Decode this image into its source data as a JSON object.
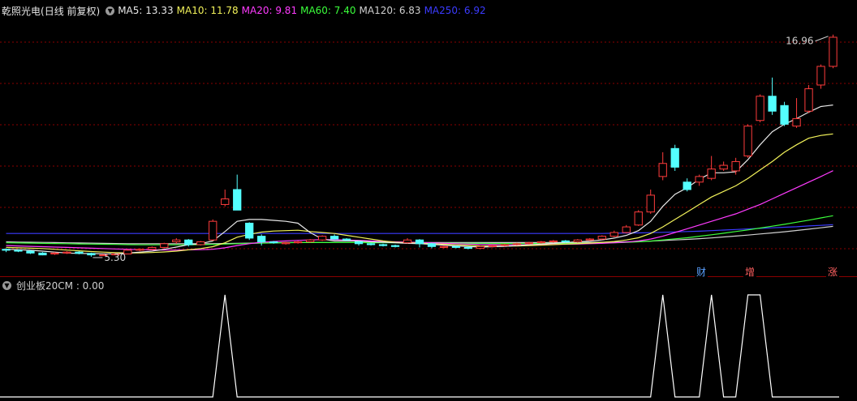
{
  "header": {
    "stock_name": "乾照光电",
    "period": "(日线 前复权)",
    "ma_labels": [
      {
        "text": "MA5: 13.33",
        "color": "#e8e8e8"
      },
      {
        "text": "MA10: 11.78",
        "color": "#f2f25a"
      },
      {
        "text": "MA20: 9.81",
        "color": "#ff3bff"
      },
      {
        "text": "MA60: 7.40",
        "color": "#3bff3b"
      },
      {
        "text": "MA120: 6.83",
        "color": "#cfcfcf"
      },
      {
        "text": "MA250: 6.92",
        "color": "#3b3bff"
      }
    ]
  },
  "annotations": {
    "high_label": "16.96",
    "low_label": "5.30",
    "markers": [
      {
        "text": "财",
        "color": "#5aa0ff",
        "index": 55
      },
      {
        "text": "增",
        "color": "#ff6060",
        "index": 60
      },
      {
        "text": "涨",
        "color": "#ff6060",
        "index": 68
      }
    ]
  },
  "indicator": {
    "label": "创业板20CM : 0.00",
    "color": "#ffffff"
  },
  "colors": {
    "up": "#ff3c3c",
    "down": "#54ffff",
    "grid": "#8b0000",
    "ma5": "#e8e8e8",
    "ma10": "#f2f25a",
    "ma20": "#ff3bff",
    "ma60": "#3bff3b",
    "ma120": "#cfcfcf",
    "ma250": "#3b3bff"
  },
  "chart_data": {
    "type": "candlestick",
    "title": "乾照光电",
    "yrange": [
      4.2,
      18.0
    ],
    "candles": [
      [
        5.6,
        5.55,
        5.65,
        5.45
      ],
      [
        5.55,
        5.5,
        5.6,
        5.45
      ],
      [
        5.5,
        5.4,
        5.55,
        5.35
      ],
      [
        5.4,
        5.3,
        5.45,
        5.28
      ],
      [
        5.35,
        5.4,
        5.45,
        5.3
      ],
      [
        5.4,
        5.45,
        5.5,
        5.35
      ],
      [
        5.45,
        5.38,
        5.5,
        5.33
      ],
      [
        5.38,
        5.3,
        5.42,
        5.2
      ],
      [
        5.3,
        5.3,
        5.35,
        5.3
      ],
      [
        5.3,
        5.35,
        5.4,
        5.3
      ],
      [
        5.35,
        5.55,
        5.6,
        5.35
      ],
      [
        5.55,
        5.6,
        5.65,
        5.5
      ],
      [
        5.6,
        5.7,
        5.75,
        5.55
      ],
      [
        5.7,
        5.9,
        5.95,
        5.65
      ],
      [
        6.0,
        6.1,
        6.2,
        5.9
      ],
      [
        6.1,
        5.85,
        6.15,
        5.75
      ],
      [
        5.85,
        6.0,
        6.05,
        5.8
      ],
      [
        6.1,
        7.1,
        7.2,
        6.05
      ],
      [
        8.0,
        8.3,
        8.8,
        7.9
      ],
      [
        8.8,
        7.7,
        9.6,
        7.7
      ],
      [
        7.0,
        6.2,
        7.05,
        6.1
      ],
      [
        6.3,
        6.0,
        6.4,
        5.8
      ],
      [
        6.0,
        5.95,
        6.05,
        5.9
      ],
      [
        5.9,
        5.95,
        6.0,
        5.85
      ],
      [
        5.95,
        6.0,
        6.05,
        5.9
      ],
      [
        6.0,
        6.1,
        6.15,
        5.95
      ],
      [
        6.1,
        6.3,
        6.35,
        6.05
      ],
      [
        6.3,
        6.15,
        6.4,
        6.1
      ],
      [
        6.15,
        6.1,
        6.2,
        6.05
      ],
      [
        6.0,
        5.9,
        6.05,
        5.8
      ],
      [
        5.9,
        5.85,
        5.95,
        5.8
      ],
      [
        5.85,
        5.8,
        5.9,
        5.75
      ],
      [
        5.8,
        5.75,
        5.85,
        5.7
      ],
      [
        5.95,
        6.1,
        6.2,
        5.9
      ],
      [
        6.1,
        5.9,
        6.15,
        5.7
      ],
      [
        5.9,
        5.75,
        5.95,
        5.65
      ],
      [
        5.7,
        5.75,
        5.8,
        5.65
      ],
      [
        5.75,
        5.7,
        5.8,
        5.65
      ],
      [
        5.7,
        5.65,
        5.75,
        5.6
      ],
      [
        5.65,
        5.75,
        5.8,
        5.6
      ],
      [
        5.75,
        5.8,
        5.85,
        5.7
      ],
      [
        5.8,
        5.85,
        5.9,
        5.75
      ],
      [
        5.85,
        5.9,
        5.95,
        5.8
      ],
      [
        5.9,
        5.95,
        6.0,
        5.85
      ],
      [
        5.95,
        6.0,
        6.05,
        5.9
      ],
      [
        6.0,
        6.05,
        6.1,
        5.95
      ],
      [
        6.05,
        6.0,
        6.1,
        5.95
      ],
      [
        6.0,
        6.1,
        6.15,
        5.95
      ],
      [
        6.1,
        6.15,
        6.2,
        6.05
      ],
      [
        6.15,
        6.3,
        6.35,
        6.1
      ],
      [
        6.3,
        6.5,
        6.6,
        6.25
      ],
      [
        6.5,
        6.8,
        6.9,
        6.45
      ],
      [
        6.9,
        7.6,
        7.7,
        6.85
      ],
      [
        7.6,
        8.5,
        8.8,
        7.5
      ],
      [
        9.5,
        10.2,
        10.8,
        9.3
      ],
      [
        11.0,
        10.0,
        11.2,
        9.8
      ],
      [
        9.2,
        8.8,
        9.4,
        8.7
      ],
      [
        9.2,
        9.5,
        9.6,
        9.0
      ],
      [
        9.4,
        9.9,
        10.6,
        9.3
      ],
      [
        9.9,
        10.1,
        10.3,
        9.8
      ],
      [
        9.8,
        10.3,
        10.5,
        9.6
      ],
      [
        10.6,
        12.2,
        12.3,
        10.5
      ],
      [
        12.5,
        13.8,
        13.9,
        12.4
      ],
      [
        13.8,
        13.0,
        14.8,
        12.8
      ],
      [
        13.3,
        12.3,
        13.5,
        12.2
      ],
      [
        12.2,
        12.6,
        13.7,
        12.1
      ],
      [
        13.0,
        14.2,
        14.4,
        12.9
      ],
      [
        14.4,
        15.4,
        15.5,
        14.2
      ],
      [
        15.4,
        16.96,
        17.1,
        15.3
      ]
    ],
    "ma_series": [
      {
        "name": "MA5",
        "values": [
          5.6,
          5.58,
          5.55,
          5.5,
          5.45,
          5.4,
          5.38,
          5.37,
          5.36,
          5.35,
          5.4,
          5.45,
          5.5,
          5.6,
          5.72,
          5.85,
          5.9,
          6.05,
          6.55,
          7.1,
          7.2,
          7.2,
          7.15,
          7.1,
          7.0,
          6.5,
          6.15,
          6.05,
          6.05,
          6.05,
          6.0,
          5.98,
          5.95,
          5.92,
          5.9,
          5.86,
          5.82,
          5.78,
          5.75,
          5.72,
          5.74,
          5.76,
          5.8,
          5.84,
          5.88,
          5.92,
          5.96,
          6.0,
          6.04,
          6.1,
          6.2,
          6.35,
          6.6,
          7.1,
          7.9,
          8.55,
          8.9,
          9.35,
          9.7,
          9.7,
          9.75,
          10.4,
          11.2,
          11.9,
          12.3,
          12.6,
          12.95,
          13.25,
          13.33
        ]
      },
      {
        "name": "MA10",
        "values": [
          5.7,
          5.68,
          5.66,
          5.64,
          5.6,
          5.56,
          5.52,
          5.48,
          5.45,
          5.42,
          5.4,
          5.41,
          5.43,
          5.46,
          5.5,
          5.57,
          5.64,
          5.74,
          5.95,
          6.25,
          6.4,
          6.52,
          6.58,
          6.6,
          6.62,
          6.55,
          6.5,
          6.45,
          6.35,
          6.25,
          6.15,
          6.05,
          5.98,
          5.95,
          5.93,
          5.9,
          5.87,
          5.84,
          5.81,
          5.78,
          5.77,
          5.77,
          5.78,
          5.8,
          5.82,
          5.85,
          5.88,
          5.9,
          5.93,
          5.97,
          6.02,
          6.1,
          6.22,
          6.45,
          6.8,
          7.2,
          7.6,
          8.0,
          8.4,
          8.7,
          9.0,
          9.4,
          9.85,
          10.3,
          10.8,
          11.2,
          11.55,
          11.7,
          11.78
        ]
      },
      {
        "name": "MA20",
        "values": [
          5.8,
          5.78,
          5.76,
          5.74,
          5.72,
          5.7,
          5.68,
          5.66,
          5.64,
          5.62,
          5.6,
          5.58,
          5.57,
          5.56,
          5.56,
          5.57,
          5.58,
          5.6,
          5.68,
          5.8,
          5.9,
          5.98,
          6.02,
          6.05,
          6.08,
          6.1,
          6.12,
          6.12,
          6.1,
          6.08,
          6.05,
          6.02,
          6.0,
          5.98,
          5.96,
          5.94,
          5.92,
          5.9,
          5.88,
          5.86,
          5.85,
          5.84,
          5.84,
          5.84,
          5.85,
          5.86,
          5.87,
          5.88,
          5.9,
          5.92,
          5.95,
          5.99,
          6.05,
          6.15,
          6.3,
          6.5,
          6.7,
          6.9,
          7.1,
          7.3,
          7.5,
          7.75,
          8.0,
          8.3,
          8.6,
          8.9,
          9.2,
          9.5,
          9.81
        ]
      },
      {
        "name": "MA60",
        "values": [
          5.95,
          5.94,
          5.93,
          5.92,
          5.91,
          5.9,
          5.89,
          5.88,
          5.87,
          5.86,
          5.85,
          5.84,
          5.84,
          5.84,
          5.84,
          5.84,
          5.85,
          5.86,
          5.88,
          5.9,
          5.92,
          5.93,
          5.94,
          5.95,
          5.96,
          5.96,
          5.96,
          5.96,
          5.96,
          5.96,
          5.95,
          5.95,
          5.95,
          5.94,
          5.94,
          5.93,
          5.93,
          5.92,
          5.92,
          5.92,
          5.91,
          5.91,
          5.91,
          5.91,
          5.91,
          5.92,
          5.92,
          5.92,
          5.93,
          5.94,
          5.95,
          5.97,
          6.0,
          6.04,
          6.1,
          6.16,
          6.22,
          6.3,
          6.38,
          6.46,
          6.55,
          6.64,
          6.74,
          6.84,
          6.94,
          7.05,
          7.16,
          7.28,
          7.4
        ]
      },
      {
        "name": "MA120",
        "values": [
          6.0,
          5.99,
          5.98,
          5.97,
          5.96,
          5.95,
          5.94,
          5.93,
          5.92,
          5.91,
          5.9,
          5.9,
          5.9,
          5.9,
          5.9,
          5.9,
          5.9,
          5.9,
          5.91,
          5.92,
          5.93,
          5.94,
          5.95,
          5.96,
          5.96,
          5.96,
          5.96,
          5.96,
          5.96,
          5.96,
          5.96,
          5.96,
          5.96,
          5.96,
          5.96,
          5.96,
          5.96,
          5.96,
          5.96,
          5.96,
          5.96,
          5.96,
          5.96,
          5.96,
          5.96,
          5.96,
          5.96,
          5.96,
          5.97,
          5.98,
          5.99,
          6.0,
          6.02,
          6.04,
          6.07,
          6.1,
          6.13,
          6.17,
          6.21,
          6.26,
          6.31,
          6.36,
          6.42,
          6.48,
          6.54,
          6.61,
          6.68,
          6.75,
          6.83
        ]
      },
      {
        "name": "MA250",
        "values": [
          6.45,
          6.45,
          6.45,
          6.45,
          6.45,
          6.45,
          6.45,
          6.45,
          6.45,
          6.45,
          6.45,
          6.45,
          6.45,
          6.45,
          6.45,
          6.45,
          6.45,
          6.45,
          6.45,
          6.45,
          6.45,
          6.45,
          6.45,
          6.45,
          6.45,
          6.45,
          6.45,
          6.45,
          6.45,
          6.45,
          6.45,
          6.45,
          6.45,
          6.45,
          6.45,
          6.45,
          6.45,
          6.45,
          6.45,
          6.45,
          6.45,
          6.45,
          6.45,
          6.45,
          6.45,
          6.45,
          6.45,
          6.45,
          6.45,
          6.45,
          6.46,
          6.47,
          6.48,
          6.49,
          6.51,
          6.53,
          6.55,
          6.57,
          6.6,
          6.63,
          6.66,
          6.69,
          6.72,
          6.75,
          6.78,
          6.81,
          6.85,
          6.88,
          6.92
        ]
      }
    ],
    "indicator_values": [
      0,
      0,
      0,
      0,
      0,
      0,
      0,
      0,
      0,
      0,
      0,
      0,
      0,
      0,
      0,
      0,
      0,
      0,
      1,
      0,
      0,
      0,
      0,
      0,
      0,
      0,
      0,
      0,
      0,
      0,
      0,
      0,
      0,
      0,
      0,
      0,
      0,
      0,
      0,
      0,
      0,
      0,
      0,
      0,
      0,
      0,
      0,
      0,
      0,
      0,
      0,
      0,
      0,
      0,
      1,
      0,
      0,
      0,
      1,
      0,
      0,
      1,
      1,
      0,
      0,
      0,
      0,
      0,
      0
    ]
  }
}
